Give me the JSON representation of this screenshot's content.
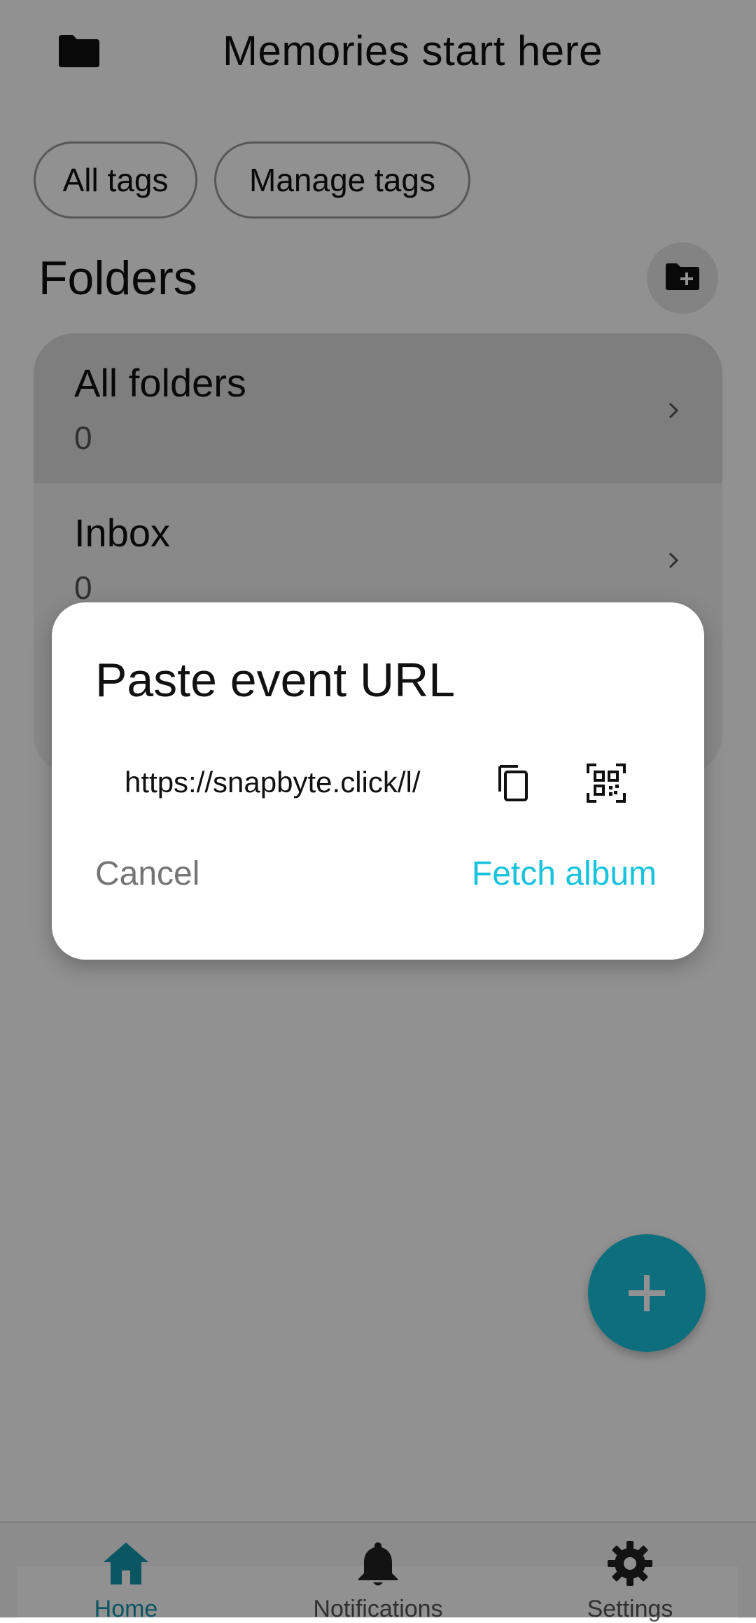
{
  "header": {
    "title": "Memories start here",
    "icon": "folder-icon"
  },
  "chips": [
    {
      "label": "All tags"
    },
    {
      "label": "Manage tags"
    }
  ],
  "folders": {
    "heading": "Folders",
    "add_icon": "create-new-folder-icon",
    "items": [
      {
        "name": "All folders",
        "count": "0"
      },
      {
        "name": "Inbox",
        "count": "0"
      }
    ]
  },
  "fab": {
    "icon": "plus-icon"
  },
  "bottom_nav": {
    "items": [
      {
        "label": "Home",
        "icon": "home-icon",
        "active": true
      },
      {
        "label": "Notifications",
        "icon": "bell-icon",
        "active": false
      },
      {
        "label": "Settings",
        "icon": "gear-icon",
        "active": false
      }
    ]
  },
  "dialog": {
    "title": "Paste event URL",
    "url_value": "https://snapbyte.click/l/",
    "paste_icon": "copy-icon",
    "scan_icon": "qr-scan-icon",
    "cancel_label": "Cancel",
    "confirm_label": "Fetch album"
  },
  "colors": {
    "accent": "#17c3dc",
    "nav_active": "#1397ad",
    "scrim": "rgba(0,0,0,0.43)"
  }
}
